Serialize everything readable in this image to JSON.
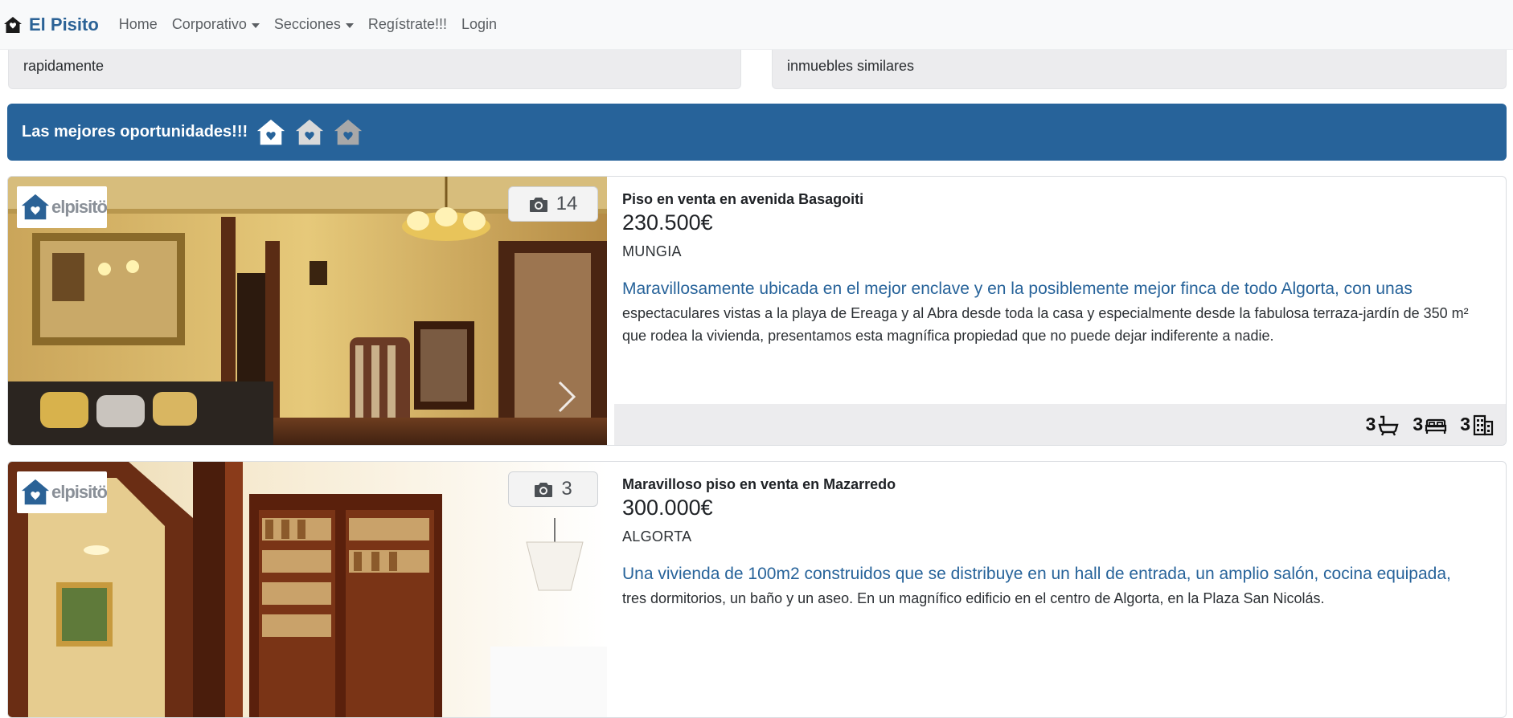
{
  "nav": {
    "brand": "El Pisito",
    "items": [
      {
        "label": "Home",
        "dropdown": false
      },
      {
        "label": "Corporativo",
        "dropdown": true
      },
      {
        "label": "Secciones",
        "dropdown": true
      },
      {
        "label": "Regístrate!!!",
        "dropdown": false
      },
      {
        "label": "Login",
        "dropdown": false
      }
    ]
  },
  "top_cards": {
    "left_text": "rapidamente",
    "right_text": "inmuebles similares"
  },
  "banner": {
    "title": "Las mejores oportunidades!!!",
    "icons": [
      "house-heart-icon",
      "house-heart-icon",
      "house-heart-icon"
    ]
  },
  "listings": [
    {
      "title": "Piso en venta en avenida Basagoiti",
      "price": "230.500€",
      "city": "MUNGIA",
      "lead": "Maravillosamente ubicada en el mejor enclave y en la posiblemente mejor finca de todo Algorta, con unas",
      "description": "espectaculares vistas a la playa de Ereaga y al Abra desde toda la casa y especialmente desde la fabulosa terraza-jardín de 350 m² que rodea la vivienda, presentamos esta magnífica propiedad que no puede dejar indiferente a nadie.",
      "photo_count": "14",
      "logo_text": "elpisitö",
      "features": {
        "baths": "3",
        "beds": "3",
        "floor": "3"
      }
    },
    {
      "title": "Maravilloso piso en venta en Mazarredo",
      "price": "300.000€",
      "city": "ALGORTA",
      "lead": "Una vivienda de 100m2 construidos que se distribuye en un hall de entrada, un amplio salón, cocina equipada,",
      "description": "tres dormitorios, un baño y un aseo. En un magnífico edificio en el centro de Algorta, en la Plaza San Nicolás.",
      "photo_count": "3",
      "logo_text": "elpisitö"
    }
  ],
  "colors": {
    "brand": "#2b6296",
    "banner": "#27639a",
    "lead_text": "#27639a",
    "panel_gray": "#ececee"
  }
}
